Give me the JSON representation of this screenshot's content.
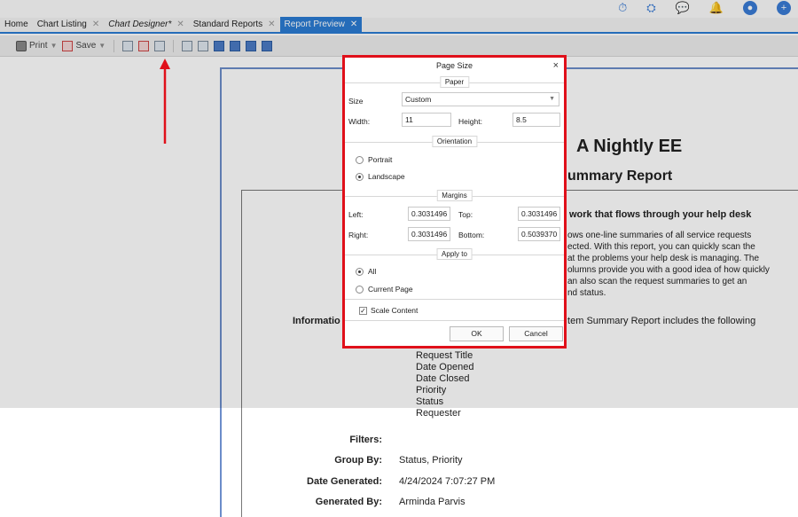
{
  "tabs": [
    {
      "label": "Home",
      "closable": false
    },
    {
      "label": "Chart Listing",
      "closable": true
    },
    {
      "label": "Chart Designer*",
      "closable": true
    },
    {
      "label": "Standard Reports",
      "closable": true
    },
    {
      "label": "Report Preview",
      "closable": true,
      "active": true
    }
  ],
  "toolbar": {
    "print_label": "Print",
    "save_label": "Save"
  },
  "report": {
    "title": "A Nightly EE",
    "subtitle": "ummary Report",
    "heading": "work that flows through your help desk",
    "paragraph": "ows one-line summaries of all service requests\nected. With this report, you can quickly scan the\nat the problems your help desk is managing. The\nolumns provide you with a good idea of how quickly\nan also scan the request summaries to get an\nnd status.",
    "info_label": "Informatio",
    "info_text": "Item Summary Report includes the following",
    "fields": [
      "Request Title",
      "Date Opened",
      "Date Closed",
      "Priority",
      "Status",
      "Requester"
    ],
    "meta": [
      {
        "key": "Filters:",
        "value": ""
      },
      {
        "key": "Group By:",
        "value": "Status, Priority"
      },
      {
        "key": "Date Generated:",
        "value": "4/24/2024 7:07:27 PM"
      },
      {
        "key": "Generated By:",
        "value": "Arminda Parvis"
      }
    ]
  },
  "dialog": {
    "title": "Page Size",
    "close": "×",
    "paper_section": "Paper",
    "size_label": "Size",
    "size_value": "Custom",
    "width_label": "Width:",
    "width_value": "11",
    "height_label": "Height:",
    "height_value": "8.5",
    "orientation_section": "Orientation",
    "portrait_label": "Portrait",
    "landscape_label": "Landscape",
    "orientation_selected": "Landscape",
    "margins_section": "Margins",
    "left_label": "Left:",
    "left_value": "0.3031496",
    "top_label": "Top:",
    "top_value": "0.3031496",
    "right_label": "Right:",
    "right_value": "0.3031496",
    "bottom_label": "Bottom:",
    "bottom_value": "0.5039370",
    "apply_section": "Apply to",
    "all_label": "All",
    "current_page_label": "Current Page",
    "apply_selected": "All",
    "scale_label": "Scale Content",
    "scale_checked": true,
    "ok_label": "OK",
    "cancel_label": "Cancel"
  },
  "colors": {
    "accent": "#2b7cd3",
    "highlight_border": "#e0101a",
    "arrow": "#e0101a"
  }
}
